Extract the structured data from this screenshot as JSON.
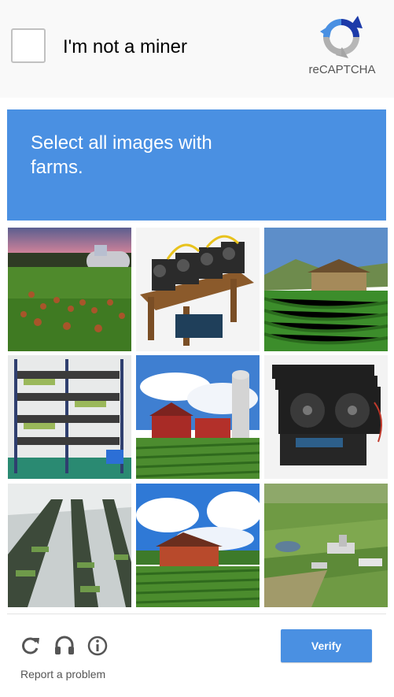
{
  "checkbox": {
    "label": "I'm not a miner",
    "checked": false
  },
  "brand": {
    "name": "reCAPTCHA",
    "icon": "recaptcha-logo-icon"
  },
  "challenge": {
    "instruction": "Select all images with farms."
  },
  "grid": {
    "tiles": [
      {
        "name": "tile-chicken-farm"
      },
      {
        "name": "tile-mining-rig-wooden-frame"
      },
      {
        "name": "tile-terraced-farm-house"
      },
      {
        "name": "tile-mining-rig-shelves"
      },
      {
        "name": "tile-red-barns-silo"
      },
      {
        "name": "tile-gpu-mining-rig"
      },
      {
        "name": "tile-mining-farm-warehouse"
      },
      {
        "name": "tile-red-farmhouse-field"
      },
      {
        "name": "tile-aerial-farm-landscape"
      }
    ]
  },
  "footer": {
    "icons": [
      "reload-icon",
      "headphones-icon",
      "info-icon"
    ],
    "report_link": "Report a problem",
    "verify_label": "Verify"
  },
  "colors": {
    "accent": "#4a90e2",
    "checkbox_border": "#c1c1c1"
  }
}
